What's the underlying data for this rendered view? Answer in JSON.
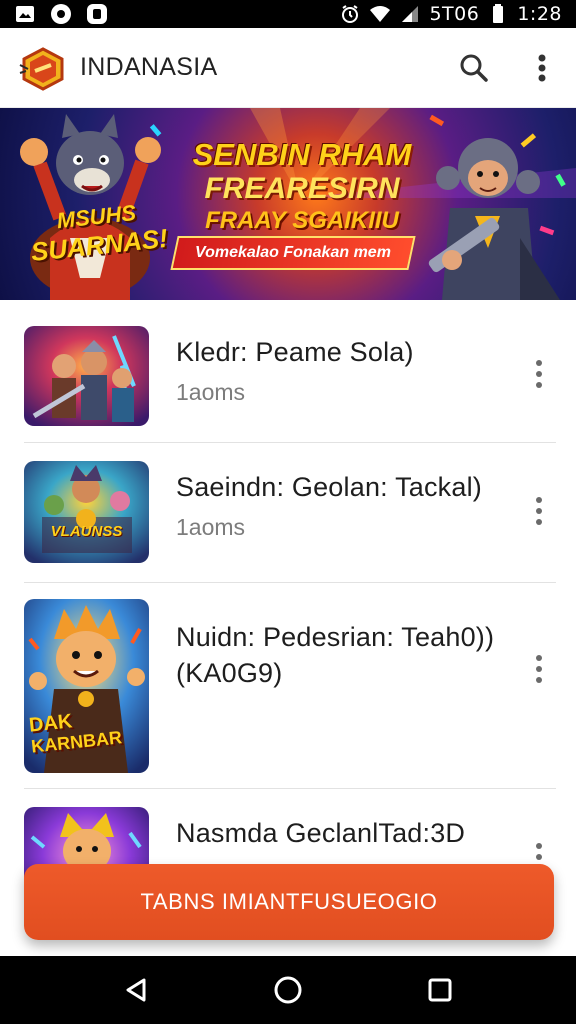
{
  "status_bar": {
    "right_text": "5T06",
    "time": "1:28"
  },
  "app_bar": {
    "title": "INDANASIA"
  },
  "banner": {
    "headline_1": "SENBIN RHAM",
    "headline_2": "FREARESIRN",
    "headline_3": "FRAAY SGAIKIIU",
    "ribbon": "Vomekalao Fonakan mem",
    "badge_1": "MSUHS",
    "badge_2": "SUARNAS!"
  },
  "list": {
    "items": [
      {
        "title": "Kledr: Peame Sola)",
        "subtitle": "1aoms"
      },
      {
        "title": "Saeindn: Geolan: Tackal)",
        "subtitle": "1aoms",
        "thumb_label": "VLAUNSS"
      },
      {
        "title": "Nuidn: Pedesrian: Teah0)) (KA0G9)",
        "subtitle": "",
        "thumb_label_1": "DAK",
        "thumb_label_2": "KARNBAR"
      },
      {
        "title": "Nasmda GeclanlTad:3D",
        "subtitle": ""
      }
    ]
  },
  "cta": {
    "label": "TABNS IMIANTFUSUEOGIO"
  },
  "colors": {
    "accent": "#e5522a",
    "status_bar": "#000000",
    "nav_bar": "#000000"
  }
}
